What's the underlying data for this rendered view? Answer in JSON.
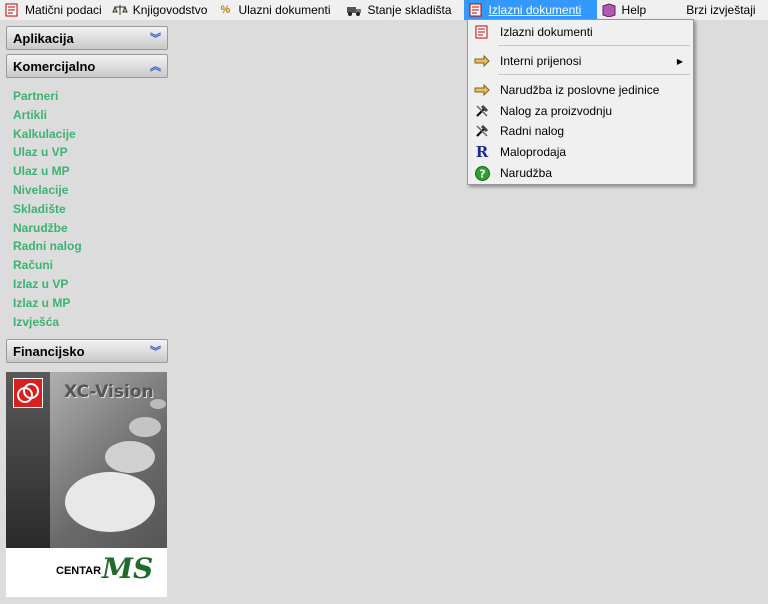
{
  "menubar": {
    "items": [
      {
        "label": "Matični podaci",
        "icon": "document-red-icon"
      },
      {
        "label": "Knjigovodstvo",
        "icon": "scales-icon"
      },
      {
        "label": "Ulazni dokumenti",
        "icon": "percent-icon"
      },
      {
        "label": "Stanje skladišta",
        "icon": "truck-icon"
      },
      {
        "label": "Izlazni dokumenti",
        "icon": "document-red-icon"
      },
      {
        "label": "Help",
        "icon": "book-icon"
      },
      {
        "label": "Brzi izvještaji",
        "icon": ""
      }
    ]
  },
  "sidebar": {
    "aplikacija": "Aplikacija",
    "komercijalno": "Komercijalno",
    "links": [
      "Partneri",
      "Artikli",
      "Kalkulacije",
      "Ulaz u VP",
      "Ulaz u MP",
      "Nivelacije",
      "Skladište",
      "Narudžbe",
      "Radni nalog",
      "Računi",
      "Izlaz u VP",
      "Izlaz u MP",
      "Izvješća"
    ],
    "financijsko": "Financijsko"
  },
  "logo": {
    "product": "XC-Vision",
    "company_a": "CENTAR",
    "company_b": "MS"
  },
  "dropdown": {
    "items": [
      {
        "label": "Izlazni dokumenti",
        "icon": "document-red-icon"
      },
      {
        "label": "Interni prijenosi",
        "icon": "arrow-right-icon",
        "submenu": "▶"
      },
      {
        "label": "Narudžba iz poslovne jedinice",
        "icon": "arrow-right-icon"
      },
      {
        "label": "Nalog za proizvodnju",
        "icon": "hammer-icon"
      },
      {
        "label": "Radni nalog",
        "icon": "hammer-icon"
      },
      {
        "label": "Maloprodaja",
        "icon": "letter-r-icon"
      },
      {
        "label": "Narudžba",
        "icon": "question-green-icon"
      }
    ]
  },
  "colors": {
    "link": "#3cb371",
    "menu_highlight": "#3399ff",
    "chevron": "#3060c0"
  }
}
